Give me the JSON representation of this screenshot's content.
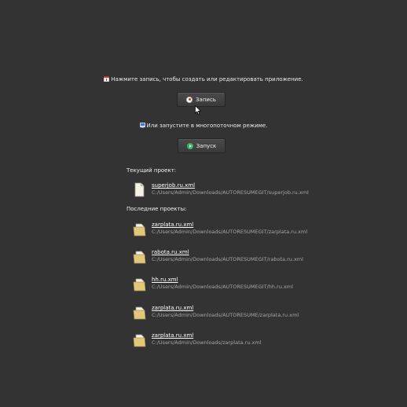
{
  "hints": {
    "record": "Нажмите запись, чтобы создать или редактировать приложение.",
    "run": "Или запустите в многопоточном режиме."
  },
  "buttons": {
    "record_label": "Запись",
    "run_label": "Запуск"
  },
  "current": {
    "heading": "Текущий проект:",
    "project": {
      "name": "superjob.ru.xml",
      "path": "C:/Users/Admin/Downloads/AUTORESUMEGIT/superjob.ru.xml"
    }
  },
  "recent": {
    "heading": "Последние проекты:",
    "projects": [
      {
        "name": "zarplata.ru.xml",
        "path": "C:/Users/Admin/Downloads/AUTORESUMEGIT/zarplata.ru.xml"
      },
      {
        "name": "rabota.ru.xml",
        "path": "C:/Users/Admin/Downloads/AUTORESUMEGIT/rabota.ru.xml"
      },
      {
        "name": "hh.ru.xml",
        "path": "C:/Users/Admin/Downloads/AUTORESUMEGIT/hh.ru.xml"
      },
      {
        "name": "zarplata.ru.xml",
        "path": "C:/Users/Admin/Downloads/AUTORESUME/zarplata.ru.xml"
      },
      {
        "name": "zarplata.ru.xml",
        "path": "C:/Users/Admin/Downloads/zarplata.ru.xml"
      }
    ]
  },
  "icons": {
    "record_hint": "info-record-icon",
    "run_hint": "info-run-icon",
    "record_button": "record-icon",
    "run_button": "play-icon",
    "current_file": "document-icon",
    "recent_file": "folder-file-icon"
  },
  "colors": {
    "background": "#333333",
    "record_accent": "#d8322c",
    "play_accent": "#36b86a",
    "folder": "#e0c878"
  }
}
